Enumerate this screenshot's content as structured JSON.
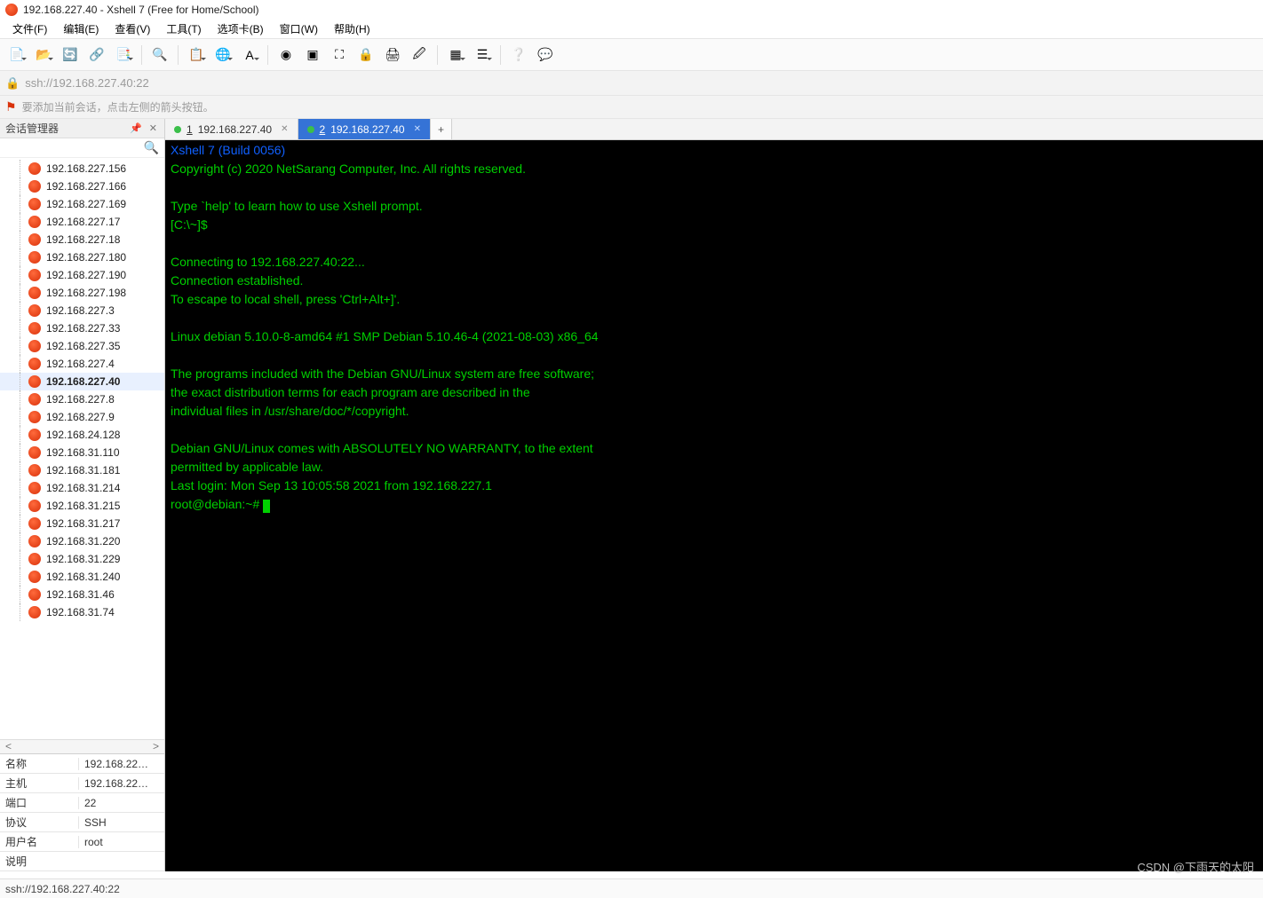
{
  "window": {
    "title": "192.168.227.40 - Xshell 7 (Free for Home/School)"
  },
  "menu": [
    "文件(F)",
    "编辑(E)",
    "查看(V)",
    "工具(T)",
    "选项卡(B)",
    "窗口(W)",
    "帮助(H)"
  ],
  "address": {
    "url": "ssh://192.168.227.40:22"
  },
  "hint": {
    "msg": "要添加当前会话，点击左侧的箭头按钮。"
  },
  "sidebar": {
    "title": "会话管理器",
    "sessions": [
      "192.168.227.156",
      "192.168.227.166",
      "192.168.227.169",
      "192.168.227.17",
      "192.168.227.18",
      "192.168.227.180",
      "192.168.227.190",
      "192.168.227.198",
      "192.168.227.3",
      "192.168.227.33",
      "192.168.227.35",
      "192.168.227.4",
      "192.168.227.40",
      "192.168.227.8",
      "192.168.227.9",
      "192.168.24.128",
      "192.168.31.110",
      "192.168.31.181",
      "192.168.31.214",
      "192.168.31.215",
      "192.168.31.217",
      "192.168.31.220",
      "192.168.31.229",
      "192.168.31.240",
      "192.168.31.46",
      "192.168.31.74"
    ],
    "selected": "192.168.227.40"
  },
  "props": {
    "rows": [
      {
        "k": "名称",
        "v": "192.168.22…"
      },
      {
        "k": "主机",
        "v": "192.168.22…"
      },
      {
        "k": "端口",
        "v": "22"
      },
      {
        "k": "协议",
        "v": "SSH"
      },
      {
        "k": "用户名",
        "v": "root"
      },
      {
        "k": "说明",
        "v": ""
      }
    ]
  },
  "tabs": {
    "items": [
      {
        "num": "1",
        "label": "192.168.227.40",
        "active": false
      },
      {
        "num": "2",
        "label": "192.168.227.40",
        "active": true
      }
    ]
  },
  "terminal": {
    "build": "Xshell 7 (Build 0056)",
    "lines": [
      "Copyright (c) 2020 NetSarang Computer, Inc. All rights reserved.",
      "",
      "Type `help' to learn how to use Xshell prompt.",
      "[C:\\~]$",
      "",
      "Connecting to 192.168.227.40:22...",
      "Connection established.",
      "To escape to local shell, press 'Ctrl+Alt+]'.",
      "",
      "Linux debian 5.10.0-8-amd64 #1 SMP Debian 5.10.46-4 (2021-08-03) x86_64",
      "",
      "The programs included with the Debian GNU/Linux system are free software;",
      "the exact distribution terms for each program are described in the",
      "individual files in /usr/share/doc/*/copyright.",
      "",
      "Debian GNU/Linux comes with ABSOLUTELY NO WARRANTY, to the extent",
      "permitted by applicable law.",
      "Last login: Mon Sep 13 10:05:58 2021 from 192.168.227.1"
    ],
    "prompt": "root@debian:~# "
  },
  "status": {
    "text": "ssh://192.168.227.40:22"
  },
  "watermark": "CSDN @下雨天的太阳",
  "toolbar": {
    "groups": [
      [
        "new-session-icon",
        "open-session-icon",
        "reconnect-icon",
        "disconnect-icon",
        "transfer-icon"
      ],
      [
        "search-icon"
      ],
      [
        "copy-icon",
        "globe-icon",
        "font-icon"
      ],
      [
        "xshell-icon",
        "xftp-icon",
        "fullscreen-icon",
        "lock-icon",
        "print-icon",
        "highlight-icon"
      ],
      [
        "tile-icon",
        "cascade-icon"
      ],
      [
        "help-icon",
        "feedback-icon"
      ]
    ],
    "glyph": {
      "new-session-icon": "📄",
      "open-session-icon": "📂",
      "reconnect-icon": "🔄",
      "disconnect-icon": "🔗",
      "transfer-icon": "📑",
      "search-icon": "🔍",
      "copy-icon": "📋",
      "globe-icon": "🌐",
      "font-icon": "A",
      "xshell-icon": "◉",
      "xftp-icon": "▣",
      "fullscreen-icon": "⛶",
      "lock-icon": "🔒",
      "print-icon": "🖨",
      "highlight-icon": "🖉",
      "tile-icon": "▦",
      "cascade-icon": "☰",
      "help-icon": "❔",
      "feedback-icon": "💬"
    },
    "dropdown": [
      "new-session-icon",
      "open-session-icon",
      "transfer-icon",
      "copy-icon",
      "globe-icon",
      "font-icon",
      "tile-icon",
      "cascade-icon"
    ]
  }
}
